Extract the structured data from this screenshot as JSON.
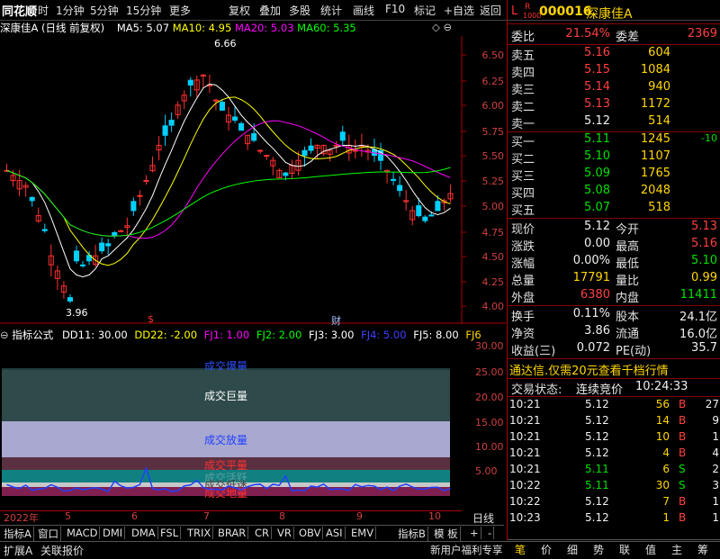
{
  "toolbar": {
    "logo": "同花顺",
    "items": [
      "分时",
      "1分钟",
      "5分钟",
      "15分钟",
      "更多",
      "复权",
      "叠加",
      "多股",
      "统计",
      "画线",
      "F10",
      "标记",
      "+自选",
      "返回"
    ]
  },
  "chart": {
    "stock_label": "深康佳A",
    "mode": "(日线 前复权)",
    "ma5": "MA5: 5.07",
    "ma10": "MA10: 4.95",
    "ma20": "MA20: 5.03",
    "ma60": "MA60: 5.35",
    "high_mark": "6.66",
    "low_mark": "3.96",
    "marker_s": "$",
    "marker_cai": "财",
    "price_ticks": [
      "6.50",
      "6.25",
      "6.00",
      "5.75",
      "5.50",
      "5.25",
      "5.00",
      "4.75",
      "4.50",
      "4.25",
      "4.00"
    ]
  },
  "indicator": {
    "title": "指标公式",
    "dd11": "DD11: 30.00",
    "dd22": "DD22: -2.00",
    "fj1": "FJ1: 1.00",
    "fj2": "FJ2: 2.00",
    "fj3": "FJ3: 3.00",
    "fj4": "FJ4: 5.00",
    "fj5": "FJ5: 8.00",
    "fj6": "FJ6",
    "ticks": [
      "30.00",
      "25.00",
      "20.00",
      "15.00",
      "10.00",
      "5.00"
    ],
    "bands": [
      "成交爆量",
      "成交巨量",
      "成交放量",
      "成交平量",
      "成交活跃",
      "成交低迷",
      "成交地量"
    ]
  },
  "time_axis": [
    "2022年",
    "5",
    "6",
    "7",
    "8",
    "9",
    "10"
  ],
  "tabs": [
    "指标A",
    "窗口",
    "MACD",
    "DMI",
    "DMA",
    "FSL",
    "TRIX",
    "BRAR",
    "CR",
    "VR",
    "OBV",
    "ASI",
    "EMV",
    "指标B",
    "模 板",
    "+",
    "-",
    "日线"
  ],
  "status": {
    "left": "扩展A",
    "assoc": "关联报价",
    "promo": "新用户福利专享"
  },
  "quote": {
    "prefix_l": "L",
    "prefix_r": "R",
    "prefix_code": "1000",
    "code": "000016",
    "name": "深康佳A",
    "weibi_label": "委比",
    "weibi": "21.54%",
    "weicha_label": "委差",
    "weicha": "2369",
    "asks": [
      {
        "label": "卖五",
        "price": "5.16",
        "vol": "604"
      },
      {
        "label": "卖四",
        "price": "5.15",
        "vol": "1084"
      },
      {
        "label": "卖三",
        "price": "5.14",
        "vol": "940"
      },
      {
        "label": "卖二",
        "price": "5.13",
        "vol": "1172"
      },
      {
        "label": "卖一",
        "price": "5.12",
        "vol": "514"
      }
    ],
    "bids": [
      {
        "label": "买一",
        "price": "5.11",
        "vol": "1245",
        "chg": "-10"
      },
      {
        "label": "买二",
        "price": "5.10",
        "vol": "1107",
        "chg": ""
      },
      {
        "label": "买三",
        "price": "5.09",
        "vol": "1765",
        "chg": ""
      },
      {
        "label": "买四",
        "price": "5.08",
        "vol": "2048",
        "chg": ""
      },
      {
        "label": "买五",
        "price": "5.07",
        "vol": "518",
        "chg": ""
      }
    ],
    "stats": [
      {
        "l1": "现价",
        "v1": "5.12",
        "c1": "white",
        "l2": "今开",
        "v2": "5.13",
        "c2": "red"
      },
      {
        "l1": "涨跌",
        "v1": "0.00",
        "c1": "white",
        "l2": "最高",
        "v2": "5.16",
        "c2": "red"
      },
      {
        "l1": "涨幅",
        "v1": "0.00%",
        "c1": "white",
        "l2": "最低",
        "v2": "5.10",
        "c2": "green"
      },
      {
        "l1": "总量",
        "v1": "17791",
        "c1": "yellow",
        "l2": "量比",
        "v2": "0.99",
        "c2": "yellow"
      },
      {
        "l1": "外盘",
        "v1": "6380",
        "c1": "red",
        "l2": "内盘",
        "v2": "11411",
        "c2": "green"
      }
    ],
    "stats2": [
      {
        "l1": "换手",
        "v1": "0.11%",
        "l2": "股本",
        "v2": "24.1亿"
      },
      {
        "l1": "净资",
        "v1": "3.86",
        "l2": "流通",
        "v2": "16.0亿"
      },
      {
        "l1": "收益(三)",
        "v1": "0.072",
        "l2": "PE(动)",
        "v2": "35.7"
      }
    ],
    "promo": "通达信.仅需20元查看千档行情",
    "trade_state_label": "交易状态:",
    "trade_state": "连续竞价",
    "time": "10:24:33",
    "ticks": [
      {
        "t": "10:21",
        "p": "5.12",
        "v": "56",
        "bs": "B",
        "n": "27",
        "pc": "white",
        "bc": "red"
      },
      {
        "t": "10:21",
        "p": "5.12",
        "v": "14",
        "bs": "B",
        "n": "9",
        "pc": "white",
        "bc": "red"
      },
      {
        "t": "10:21",
        "p": "5.12",
        "v": "10",
        "bs": "B",
        "n": "1",
        "pc": "white",
        "bc": "red"
      },
      {
        "t": "10:21",
        "p": "5.12",
        "v": "4",
        "bs": "B",
        "n": "4",
        "pc": "white",
        "bc": "red"
      },
      {
        "t": "10:21",
        "p": "5.11",
        "v": "6",
        "bs": "S",
        "n": "2",
        "pc": "green",
        "bc": "green"
      },
      {
        "t": "10:22",
        "p": "5.11",
        "v": "30",
        "bs": "S",
        "n": "3",
        "pc": "green",
        "bc": "green"
      },
      {
        "t": "10:22",
        "p": "5.12",
        "v": "7",
        "bs": "B",
        "n": "1",
        "pc": "white",
        "bc": "red"
      },
      {
        "t": "10:23",
        "p": "5.12",
        "v": "1",
        "bs": "B",
        "n": "1",
        "pc": "white",
        "bc": "red"
      }
    ],
    "footer_tabs": [
      "笔",
      "价",
      "细",
      "势",
      "联",
      "值",
      "主",
      "筹"
    ]
  },
  "colors": {
    "up": "#ff3030",
    "down": "#00d0ff",
    "ma5": "#ffffff",
    "ma10": "#ffff00",
    "ma20": "#ff00ff",
    "ma60": "#00ff00"
  }
}
